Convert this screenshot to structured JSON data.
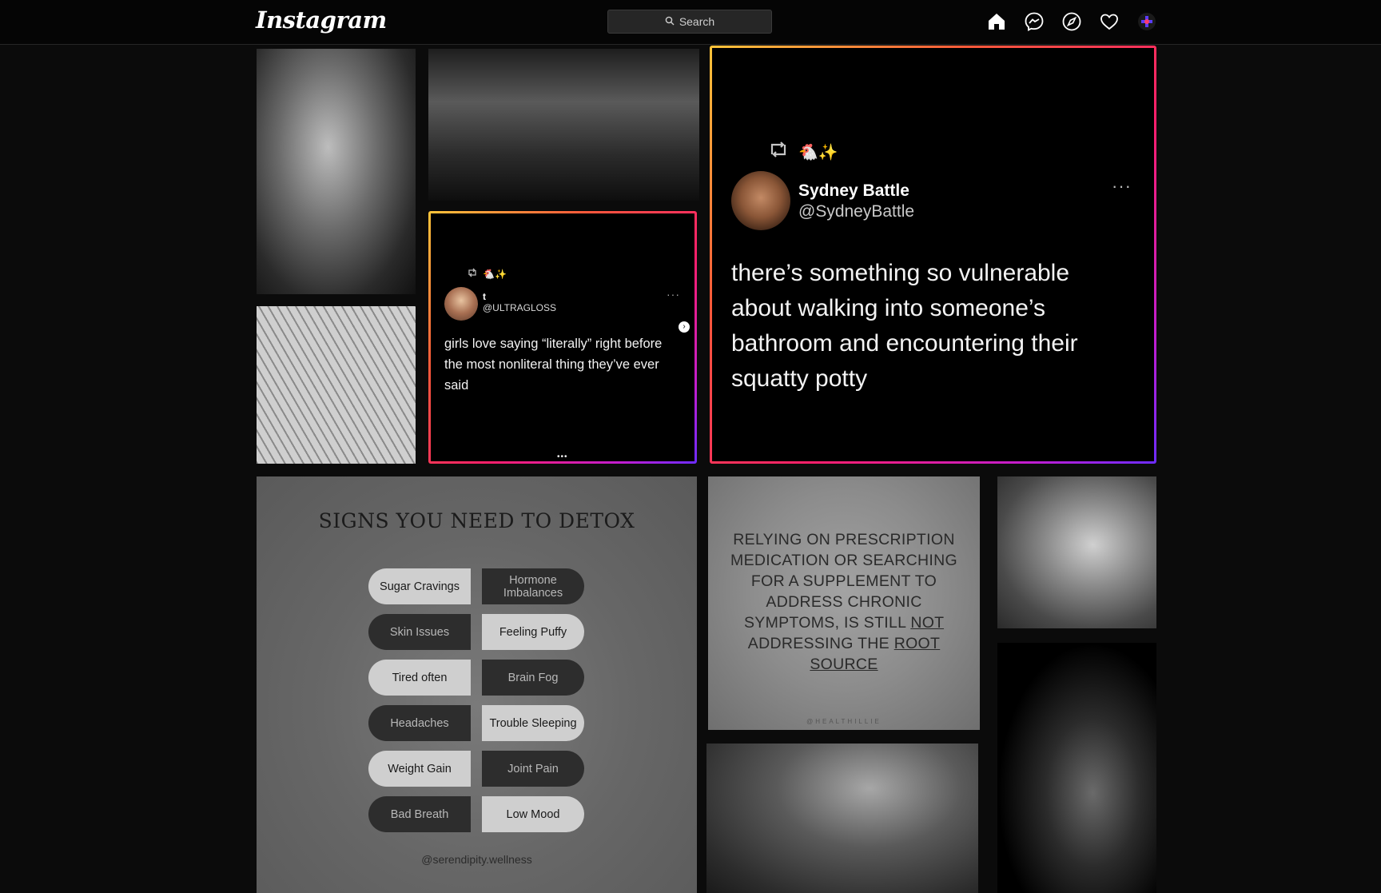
{
  "nav": {
    "logo": "Instagram",
    "search_placeholder": "Search",
    "icons": [
      "home-icon",
      "messenger-icon",
      "explore-icon",
      "heart-icon",
      "profile-avatar"
    ]
  },
  "tweet_small": {
    "reaction": "🐔✨",
    "name": "t",
    "handle": "@ULTRAGLOSS",
    "more": "···",
    "text": "girls love saying “literally” right before the most nonliteral thing they’ve ever said",
    "pager": "•••"
  },
  "tweet_big": {
    "reaction": "🐔✨",
    "name": "Sydney Battle",
    "handle": "@SydneyBattle",
    "more": "···",
    "text": "there’s something so vulnerable about walking into someone’s bathroom and encountering their squatty potty"
  },
  "detox": {
    "title": "SIGNS YOU NEED TO DETOX",
    "pills": [
      {
        "label": "Sugar Cravings",
        "style": "light"
      },
      {
        "label": "Hormone Imbalances",
        "style": "dark"
      },
      {
        "label": "Skin Issues",
        "style": "dark"
      },
      {
        "label": "Feeling Puffy",
        "style": "light"
      },
      {
        "label": "Tired often",
        "style": "light"
      },
      {
        "label": "Brain Fog",
        "style": "dark"
      },
      {
        "label": "Headaches",
        "style": "dark"
      },
      {
        "label": "Trouble Sleeping",
        "style": "light"
      },
      {
        "label": "Weight Gain",
        "style": "light"
      },
      {
        "label": "Joint Pain",
        "style": "dark"
      },
      {
        "label": "Bad Breath",
        "style": "dark"
      },
      {
        "label": "Low Mood",
        "style": "light"
      }
    ],
    "credit": "@serendipity.wellness"
  },
  "quote": {
    "text_a": "RELYING ON PRESCRIPTION MEDICATION OR SEARCHING FOR A SUPPLEMENT TO ADDRESS CHRONIC SYMPTOMS, IS STILL ",
    "text_not": "NOT",
    "text_b": " ADDRESSING THE ",
    "text_root": "ROOT SOURCE",
    "credit": "@HEALTHILLIE"
  },
  "colors": {
    "background": "#0b0b0b",
    "frame_gradient": [
      "#ffc53a",
      "#ff1f6b",
      "#6c2cff"
    ]
  }
}
